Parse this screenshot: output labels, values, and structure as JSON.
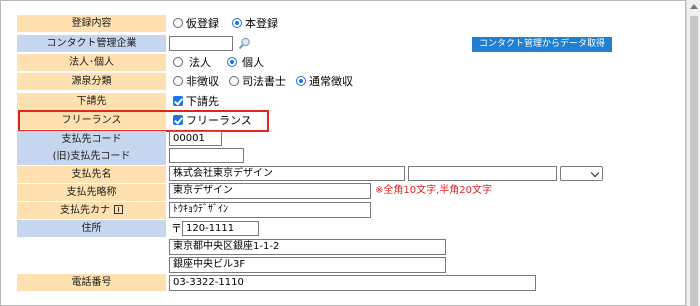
{
  "form": {
    "registration": {
      "label": "登録内容",
      "options": [
        "仮登録",
        "本登録"
      ],
      "selected_index": 1
    },
    "contact_company": {
      "label": "コンタクト管理企業",
      "value": "",
      "fetch_button": "コンタクト管理からデータ取得",
      "search_icon": "magnifier-icon"
    },
    "entity_type": {
      "label": "法人･個人",
      "options": [
        "法人",
        "個人"
      ],
      "selected_index": 1
    },
    "withholding": {
      "label": "源泉分類",
      "options": [
        "非徴収",
        "司法書士",
        "通常徴収"
      ],
      "selected_index": 2
    },
    "subcontractor": {
      "label": "下請先",
      "checkbox_label": "下請先",
      "checked": true
    },
    "freelance": {
      "label": "フリーランス",
      "checkbox_label": "フリーランス",
      "checked": true
    },
    "payee_code": {
      "label": "支払先コード",
      "value": "00001"
    },
    "old_payee_code": {
      "label": "(旧)支払先コード",
      "value": ""
    },
    "payee_name": {
      "label": "支払先名",
      "value": "株式会社東京デザイン",
      "value2": ""
    },
    "payee_short": {
      "label": "支払先略称",
      "value": "東京デザイン",
      "note": "※全角10文字,半角20文字"
    },
    "payee_kana": {
      "label": "支払先カナ",
      "value": "ﾄｳｷｮｳﾃﾞｻﾞｲﾝ",
      "info_icon": "info-icon"
    },
    "address": {
      "label": "住所",
      "postal_mark": "〒",
      "postal": "120-1111",
      "line1": "東京都中央区銀座1-1-2",
      "line2": "銀座中央ビル3F"
    },
    "phone": {
      "label": "電話番号",
      "value": "03-3322-1110"
    }
  },
  "colors": {
    "label_orange": "#ffe0b0",
    "label_blue": "#c7d6ef",
    "button_blue": "#1f7fd1",
    "highlight_red": "#e0261d",
    "note_red": "#e02020"
  }
}
